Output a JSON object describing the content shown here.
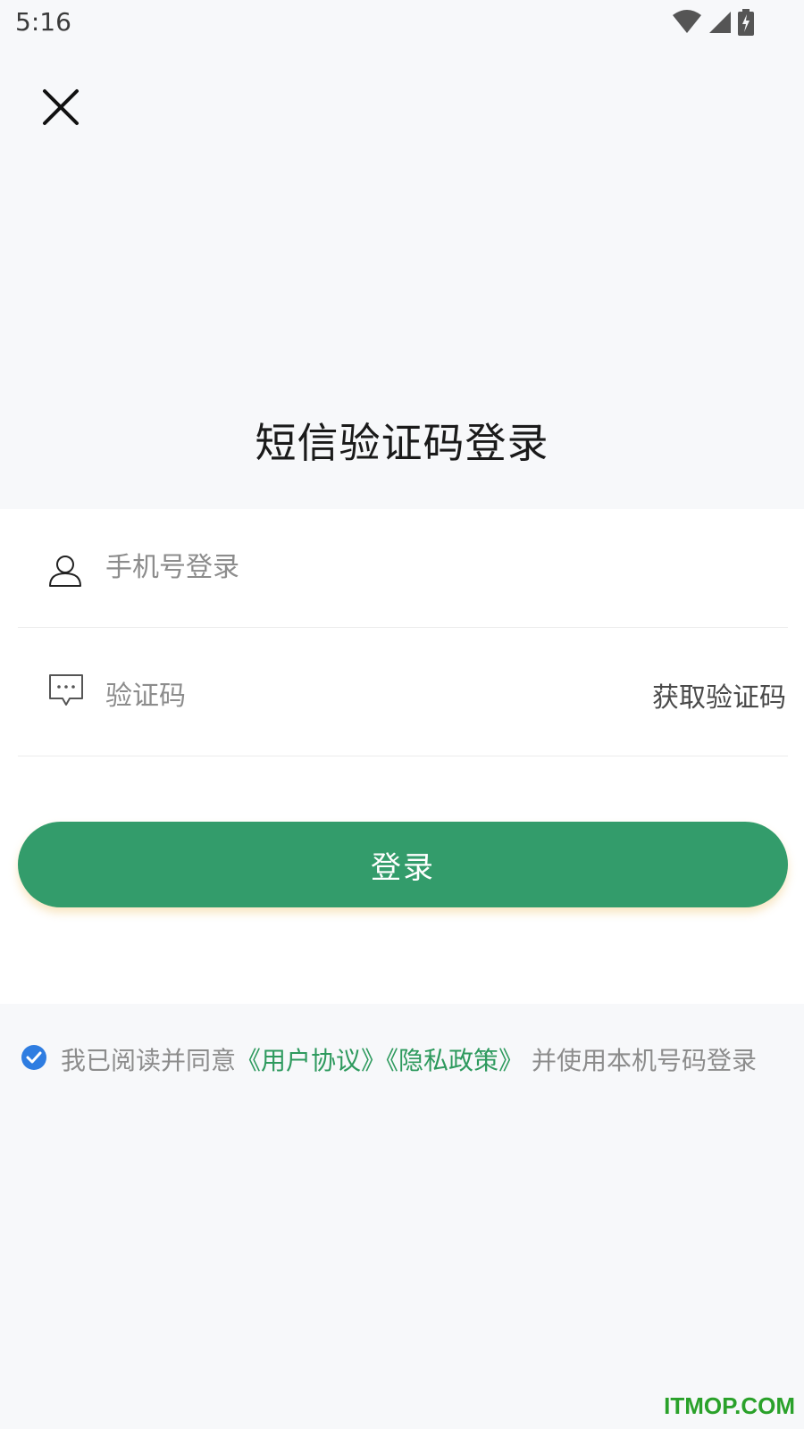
{
  "status_bar": {
    "time": "5:16",
    "icons": [
      "wifi-icon",
      "cell-signal-icon",
      "battery-charging-icon"
    ]
  },
  "header": {
    "close_icon": "close-icon",
    "title": "短信验证码登录"
  },
  "form": {
    "phone_placeholder": "手机号登录",
    "phone_value": "",
    "code_placeholder": "验证码",
    "code_value": "",
    "get_code_label": "获取验证码",
    "login_label": "登录"
  },
  "agreement": {
    "checked": true,
    "text_prefix": "我已阅读并同意",
    "user_agreement": "《用户协议》",
    "privacy_policy": "《隐私政策》",
    "text_suffix": " 并使用本机号码登录"
  },
  "watermark": "ITMOP.COM",
  "colors": {
    "primary": "#339c6b",
    "link": "#2e9a5e",
    "checkbox": "#2f7de1",
    "background": "#f7f8fa"
  }
}
